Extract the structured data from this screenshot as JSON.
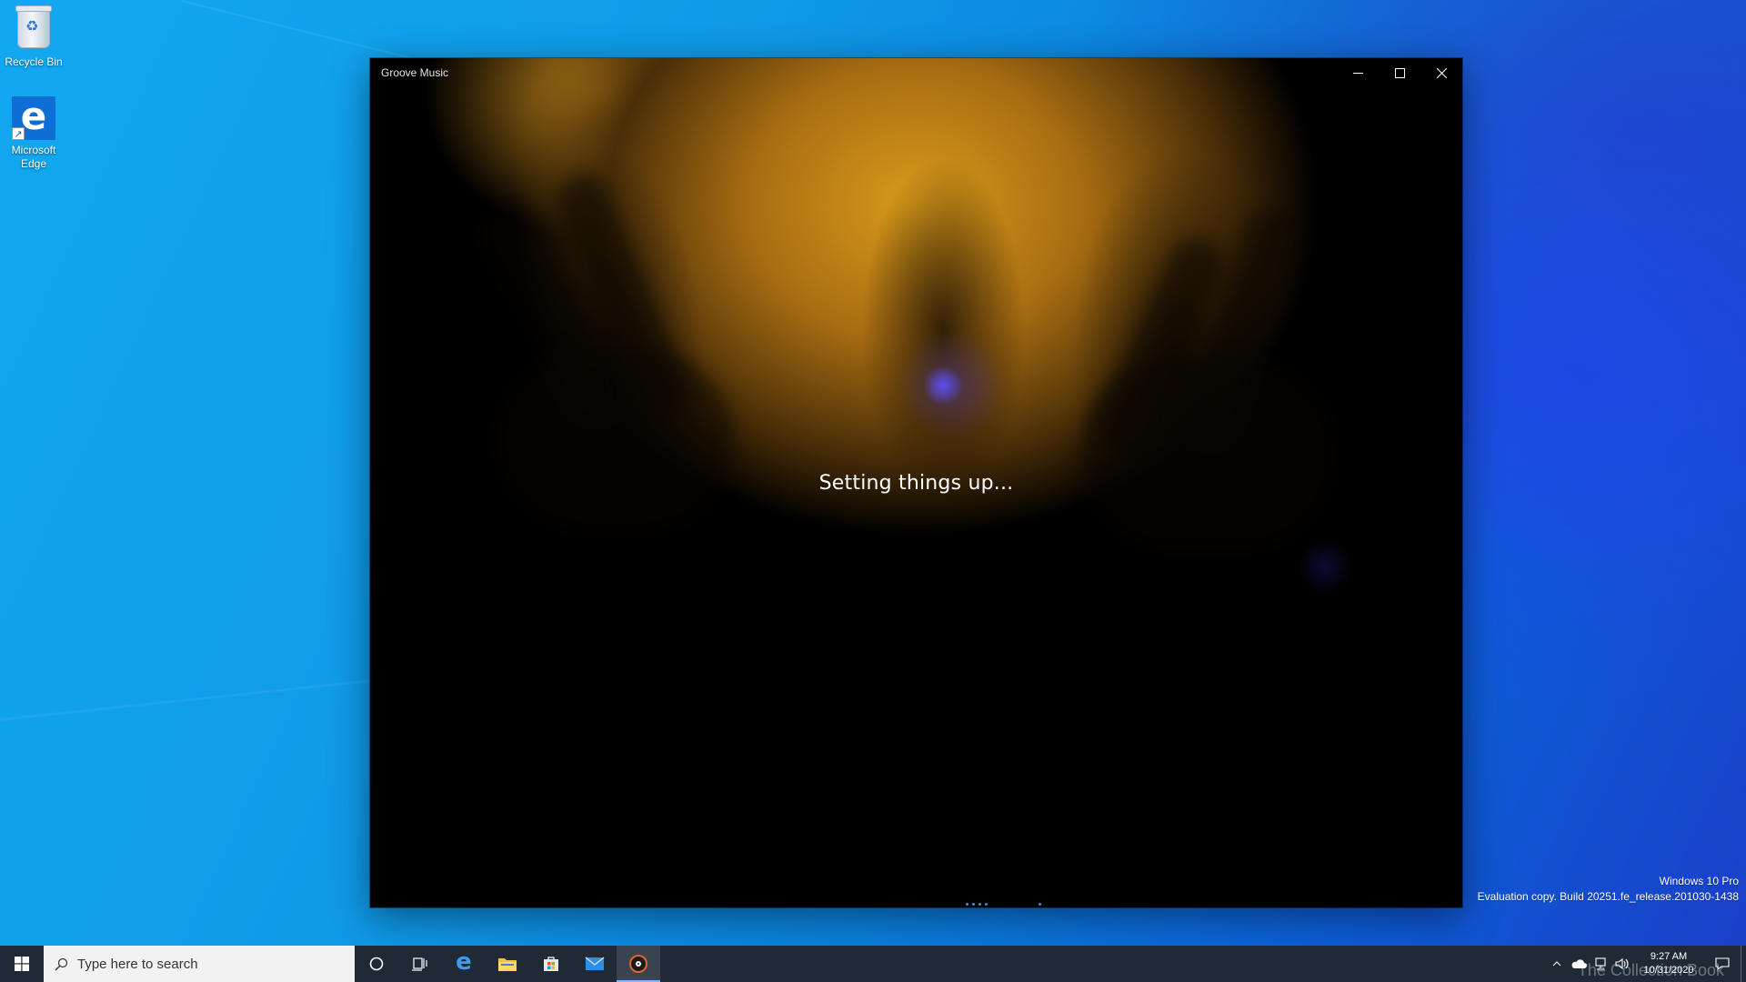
{
  "desktop": {
    "icons": [
      {
        "label": "Recycle Bin"
      },
      {
        "label": "Microsoft\nEdge"
      }
    ]
  },
  "window": {
    "title": "Groove Music",
    "status": "Setting things up...",
    "controls": {
      "minimize": "minimize",
      "maximize": "maximize",
      "close": "close"
    }
  },
  "watermark": {
    "line1": "Windows 10 Pro",
    "line2": "Evaluation copy. Build 20251.fe_release.201030-1438"
  },
  "taskbar": {
    "search_placeholder": "Type here to search",
    "pinned": [
      "cortana-icon",
      "task-view-icon",
      "edge-icon",
      "file-explorer-icon",
      "store-icon",
      "mail-icon",
      "groove-music-icon"
    ],
    "clock": {
      "time": "9:27 AM",
      "date": "10/31/2020"
    },
    "overlay_text": "The Collection Book"
  },
  "colors": {
    "accent": "#0078d7",
    "taskbar": "#1f2a36"
  }
}
